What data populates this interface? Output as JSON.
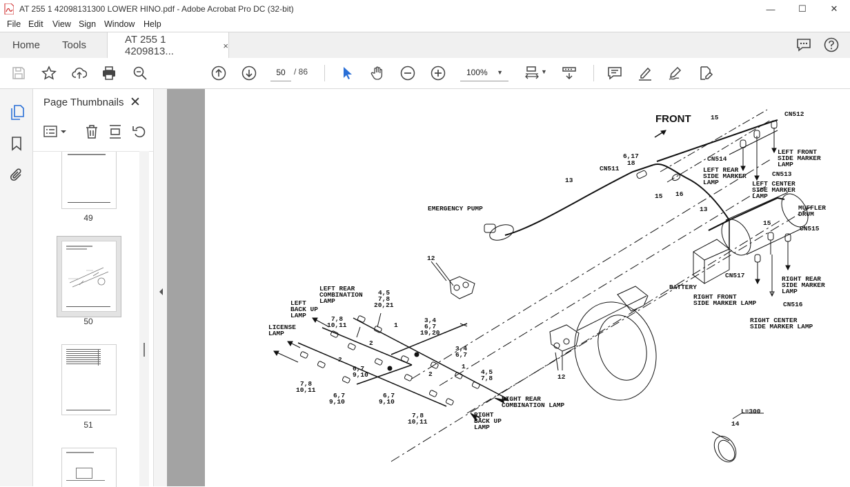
{
  "window": {
    "title": "AT 255 1 42098131300 LOWER HINO.pdf - Adobe Acrobat Pro DC (32-bit)",
    "minimize": "—",
    "maximize": "☐",
    "close": "✕"
  },
  "menu": [
    "File",
    "Edit",
    "View",
    "Sign",
    "Window",
    "Help"
  ],
  "tabs": {
    "home": "Home",
    "tools": "Tools",
    "document": "AT 255 1 4209813...",
    "close": "×"
  },
  "toolbar": {
    "current_page": "50",
    "page_total": "/ 86",
    "zoom": "100%"
  },
  "thumbnails": {
    "header": "Page Thumbnails",
    "close": "✕",
    "pages": [
      "49",
      "50",
      "51"
    ]
  },
  "drawing": {
    "front": "FRONT",
    "labels": {
      "n15a": "15",
      "cn512": "CN512",
      "n617": "6,17",
      "n18": "18",
      "cn511": "CN511",
      "cn514": "CN514",
      "left_front": "LEFT FRONT",
      "side_marker": "SIDE MARKER",
      "lamp": "LAMP",
      "left_rear": "LEFT REAR",
      "cn513": "CN513",
      "left_center": "LEFT CENTER",
      "n13a": "13",
      "n15b": "15",
      "n16": "16",
      "emergency_pump": "EMERGENCY PUMP",
      "n13b": "13",
      "muffler": "MUFFLER",
      "drum": "DRUM",
      "n15c": "15",
      "cn515": "CN515",
      "n12a": "12",
      "battery": "BATTERY",
      "cn517": "CN517",
      "right_rear": "RIGHT REAR",
      "right_front": "RIGHT FRONT",
      "side_marker_lamp": "SIDE MARKER LAMP",
      "cn516": "CN516",
      "right_center": "RIGHT CENTER",
      "left_rear_comb": "LEFT REAR",
      "combination": "COMBINATION",
      "n45a": "4,5",
      "n78a": "7,8",
      "n2021": "20,21",
      "left_back_up": "LEFT",
      "back_up": "BACK UP",
      "n78b": "7,8",
      "n1011a": "10,11",
      "n1a": "1",
      "n34a": "3,4",
      "n67a": "6,7",
      "n1920": "19,20",
      "license": "LICENSE",
      "n2a": "2",
      "n34b": "3,4",
      "n67b": "6,7",
      "n2b": "2",
      "n67c": "6,7",
      "n910a": "9,10",
      "n1b": "1",
      "n45b": "4,5",
      "n78c": "7,8",
      "n78d": "7,8",
      "n1011b": "10,11",
      "n2c": "2",
      "n67d": "6,7",
      "n910b": "9,10",
      "n67e": "6,7",
      "n910c": "9,10",
      "right_rear_comb": "RIGHT REAR",
      "combination_lamp": "COMBINATION LAMP",
      "n78e": "7,8",
      "n1011c": "10,11",
      "right": "RIGHT",
      "n12b": "12",
      "l300": "L=300",
      "n14": "14"
    }
  }
}
